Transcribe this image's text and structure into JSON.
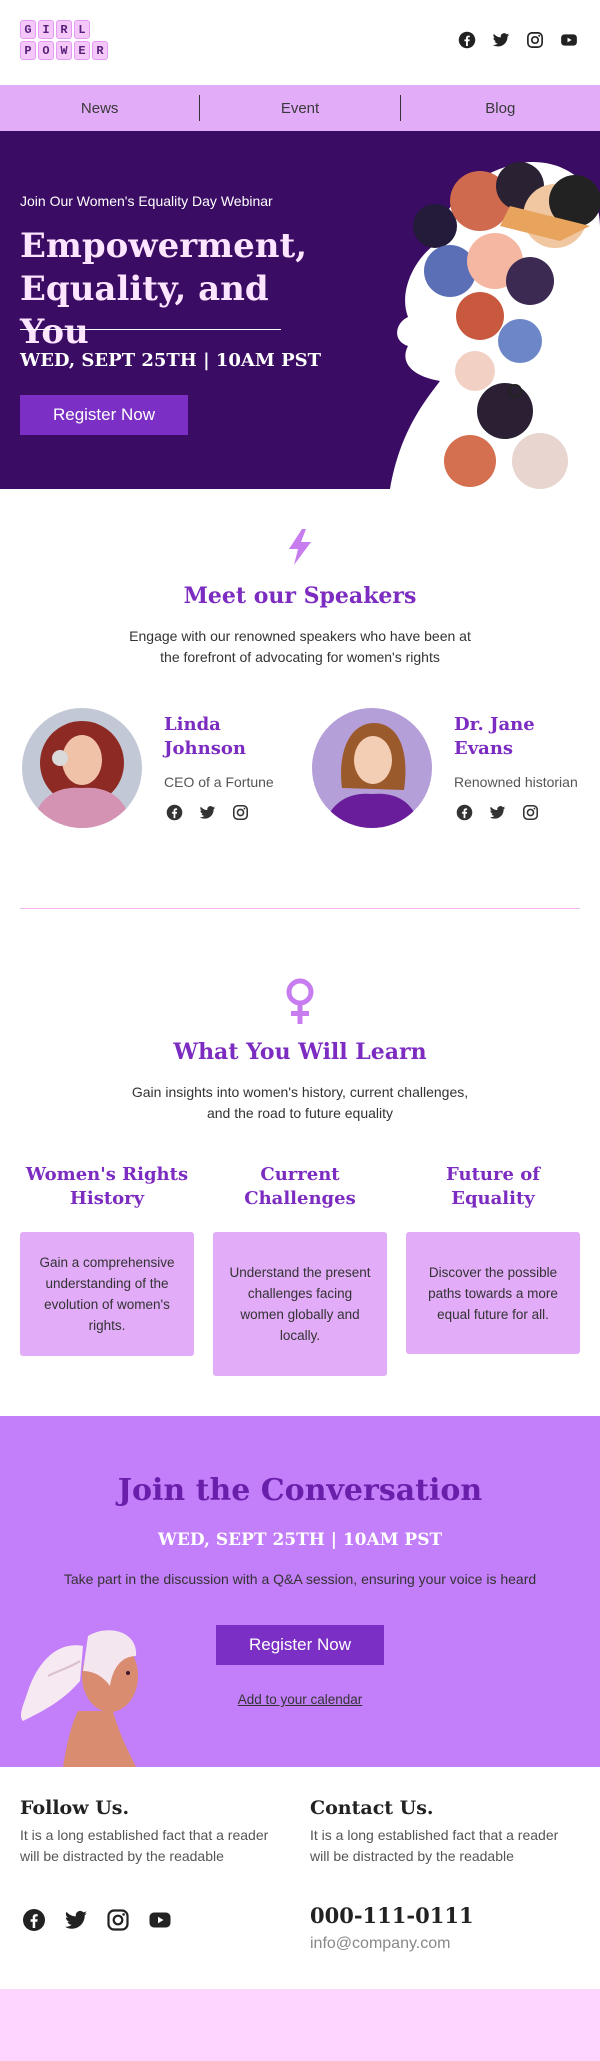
{
  "brand": {
    "logo_row1": [
      "G",
      "I",
      "R",
      "L"
    ],
    "logo_row2": [
      "P",
      "O",
      "W",
      "E",
      "R"
    ]
  },
  "nav": {
    "items": [
      "News",
      "Event",
      "Blog"
    ]
  },
  "hero": {
    "pre_title": "Join Our Women's Equality Day Webinar",
    "title": "Empowerment, Equality, and You",
    "date_time": "WED, SEPT 25TH  | 10AM PST",
    "button": "Register Now"
  },
  "speakers": {
    "title": "Meet our Speakers",
    "subtitle": "Engage with our renowned speakers who have been at the forefront of advocating for women's rights",
    "list": [
      {
        "name": "Linda Johnson",
        "role": "CEO of a Fortune"
      },
      {
        "name": "Dr. Jane Evans",
        "role": "Renowned historian"
      }
    ]
  },
  "learn": {
    "title": "What You Will Learn",
    "subtitle": "Gain insights into women's history, current challenges, and the road to future equality",
    "columns": [
      {
        "title": "Women's Rights History",
        "text": "Gain a comprehensive understanding of the evolution of women's rights."
      },
      {
        "title": "Current Challenges",
        "text": "Understand the present challenges facing women globally and locally."
      },
      {
        "title": "Future of Equality",
        "text": "Discover the possible paths towards a more equal future for all."
      }
    ]
  },
  "conversation": {
    "title": "Join the Conversation",
    "date_time": "WED, SEPT 25TH  | 10AM PST",
    "subtitle": "Take part in the discussion with a Q&A session, ensuring your voice is heard",
    "button": "Register Now",
    "calendar_link": "Add to your calendar"
  },
  "footer": {
    "follow_title": "Follow Us.",
    "follow_text": "It is a long established fact that a reader will be distracted by the readable",
    "contact_title": "Contact Us.",
    "contact_text": "It is a long established fact that a reader will be distracted by the readable",
    "phone": "000-111-0111",
    "email": "info@company.com"
  },
  "colors": {
    "primary": "#7b2fc4",
    "hero_bg": "#3a0c63",
    "nav_bg": "#e2acf8",
    "conv_bg": "#c37ffa",
    "accent_pink": "#fdd5fd"
  },
  "icons": [
    "facebook-icon",
    "twitter-icon",
    "instagram-icon",
    "youtube-icon",
    "lightning-icon",
    "female-symbol-icon"
  ]
}
